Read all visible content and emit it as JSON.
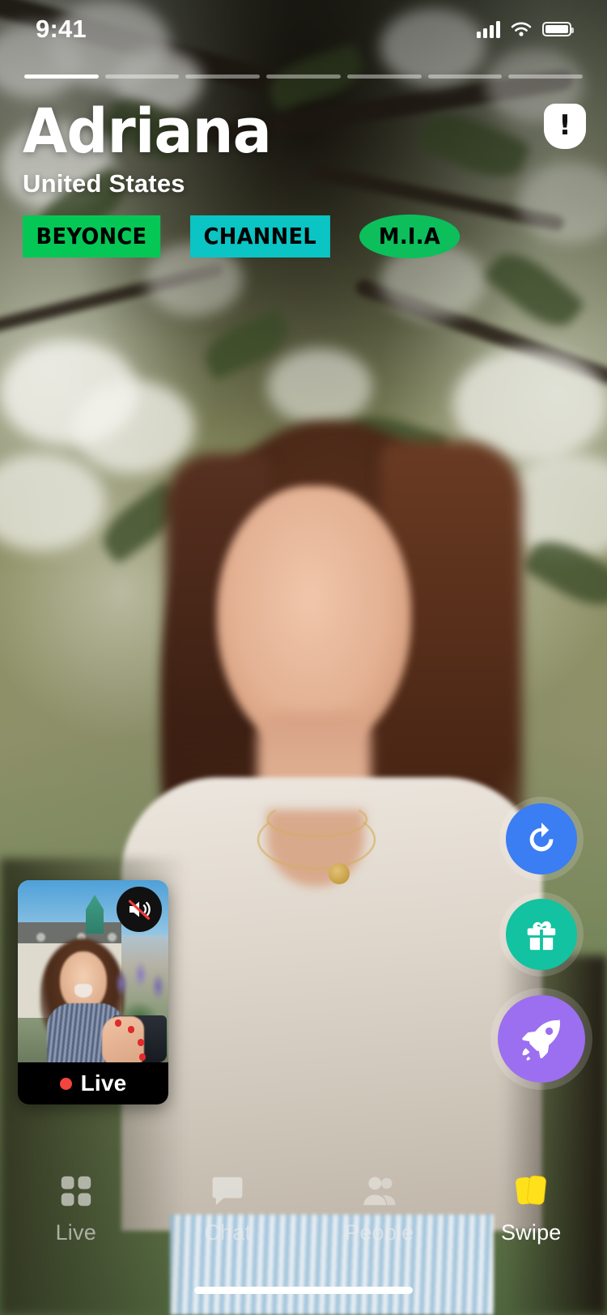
{
  "status_bar": {
    "time": "9:41",
    "cellular_icon": "signal-bars-icon",
    "wifi_icon": "wifi-icon",
    "battery_icon": "battery-full-icon"
  },
  "story_progress": {
    "total_segments": 7,
    "active_index": 0
  },
  "profile": {
    "name": "Adriana",
    "location": "United States",
    "tags": [
      {
        "label": "BEYONCE",
        "color": "#05C755",
        "shape": "rect"
      },
      {
        "label": "CHANNEL",
        "color": "#0BC4C4",
        "shape": "rect"
      },
      {
        "label": "M.I.A",
        "color": "#0CBF5B",
        "shape": "pill"
      }
    ]
  },
  "report_button": {
    "icon": "report-shield-icon",
    "glyph": "!"
  },
  "actions": [
    {
      "name": "rewind-button",
      "icon": "rewind-arrow-icon",
      "color": "#3B7DF2"
    },
    {
      "name": "gift-button",
      "icon": "gift-icon",
      "color": "#12C2A0"
    },
    {
      "name": "boost-button",
      "icon": "rocket-icon",
      "color": "#9B6FF0"
    }
  ],
  "pip": {
    "live_label": "Live",
    "live_dot_color": "#F3453F",
    "mute_icon": "speaker-muted-icon"
  },
  "bottom_nav": {
    "active_index": 3,
    "items": [
      {
        "label": "Live",
        "icon": "grid-icon"
      },
      {
        "label": "Chat",
        "icon": "chat-bubble-icon"
      },
      {
        "label": "People",
        "icon": "people-icon"
      },
      {
        "label": "Swipe",
        "icon": "cards-swipe-icon",
        "active_color": "#FFE11B"
      }
    ]
  },
  "home_indicator": {
    "name": "home-indicator"
  }
}
